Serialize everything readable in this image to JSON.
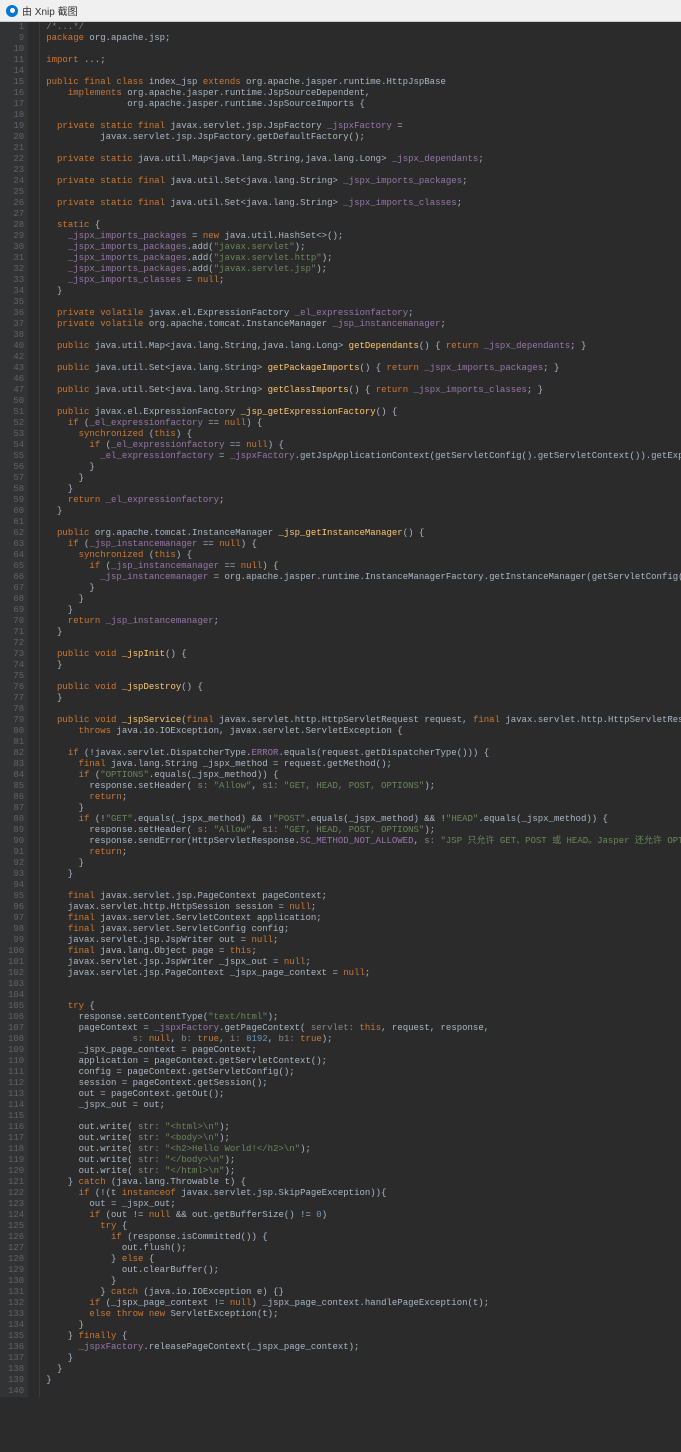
{
  "titlebar": {
    "text": "由 Xnip 截图"
  },
  "code": {
    "lines": [
      {
        "n": 1,
        "t": "<span class='cm'>/*...*/</span>"
      },
      {
        "n": 9,
        "t": "<span class='kw'>package</span> org.apache.jsp;"
      },
      {
        "n": 10,
        "t": ""
      },
      {
        "n": 11,
        "t": "<span class='kw'>import</span> ...;"
      },
      {
        "n": 14,
        "t": ""
      },
      {
        "n": 15,
        "t": "<span class='kw'>public final class</span> index_jsp <span class='kw'>extends</span> org.apache.jasper.runtime.HttpJspBase"
      },
      {
        "n": 16,
        "t": "    <span class='kw'>implements</span> org.apache.jasper.runtime.JspSourceDependent,"
      },
      {
        "n": 17,
        "t": "               org.apache.jasper.runtime.JspSourceImports {"
      },
      {
        "n": 18,
        "t": ""
      },
      {
        "n": 19,
        "t": "  <span class='kw'>private static final</span> javax.servlet.jsp.JspFactory <span class='field'>_jspxFactory</span> ="
      },
      {
        "n": 20,
        "t": "          javax.servlet.jsp.JspFactory.getDefaultFactory();"
      },
      {
        "n": 21,
        "t": ""
      },
      {
        "n": 22,
        "t": "  <span class='kw'>private static</span> java.util.Map&lt;java.lang.String,java.lang.Long&gt; <span class='field'>_jspx_dependants</span>;"
      },
      {
        "n": 23,
        "t": ""
      },
      {
        "n": 24,
        "t": "  <span class='kw'>private static final</span> java.util.Set&lt;java.lang.String&gt; <span class='field'>_jspx_imports_packages</span>;"
      },
      {
        "n": 25,
        "t": ""
      },
      {
        "n": 26,
        "t": "  <span class='kw'>private static final</span> java.util.Set&lt;java.lang.String&gt; <span class='field'>_jspx_imports_classes</span>;"
      },
      {
        "n": 27,
        "t": ""
      },
      {
        "n": 28,
        "t": "  <span class='kw'>static</span> {"
      },
      {
        "n": 29,
        "t": "    <span class='field'>_jspx_imports_packages</span> = <span class='kw'>new</span> java.util.HashSet&lt;&gt;();"
      },
      {
        "n": 30,
        "t": "    <span class='field'>_jspx_imports_packages</span>.add(<span class='str'>\"javax.servlet\"</span>);"
      },
      {
        "n": 31,
        "t": "    <span class='field'>_jspx_imports_packages</span>.add(<span class='str'>\"javax.servlet.http\"</span>);"
      },
      {
        "n": 32,
        "t": "    <span class='field'>_jspx_imports_packages</span>.add(<span class='str'>\"javax.servlet.jsp\"</span>);"
      },
      {
        "n": 33,
        "t": "    <span class='field'>_jspx_imports_classes</span> = <span class='kw'>null</span>;"
      },
      {
        "n": 34,
        "t": "  }"
      },
      {
        "n": 35,
        "t": ""
      },
      {
        "n": 36,
        "t": "  <span class='kw'>private volatile</span> javax.el.ExpressionFactory <span class='field'>_el_expressionfactory</span>;"
      },
      {
        "n": 37,
        "t": "  <span class='kw'>private volatile</span> org.apache.tomcat.InstanceManager <span class='field'>_jsp_instancemanager</span>;"
      },
      {
        "n": 38,
        "t": ""
      },
      {
        "n": 40,
        "t": "  <span class='kw'>public</span> java.util.Map&lt;java.lang.String,java.lang.Long&gt; <span class='fn'>getDependants</span>() { <span class='kw'>return</span> <span class='field'>_jspx_dependants</span>; }"
      },
      {
        "n": 42,
        "t": ""
      },
      {
        "n": 43,
        "t": "  <span class='kw'>public</span> java.util.Set&lt;java.lang.String&gt; <span class='fn'>getPackageImports</span>() { <span class='kw'>return</span> <span class='field'>_jspx_imports_packages</span>; }"
      },
      {
        "n": 46,
        "t": ""
      },
      {
        "n": 47,
        "t": "  <span class='kw'>public</span> java.util.Set&lt;java.lang.String&gt; <span class='fn'>getClassImports</span>() { <span class='kw'>return</span> <span class='field'>_jspx_imports_classes</span>; }"
      },
      {
        "n": 50,
        "t": ""
      },
      {
        "n": 51,
        "t": "  <span class='kw'>public</span> javax.el.ExpressionFactory <span class='fn'>_jsp_getExpressionFactory</span>() {"
      },
      {
        "n": 52,
        "t": "    <span class='kw'>if</span> (<span class='field'>_el_expressionfactory</span> == <span class='kw'>null</span>) {"
      },
      {
        "n": 53,
        "t": "      <span class='kw'>synchronized</span> (<span class='kw'>this</span>) {"
      },
      {
        "n": 54,
        "t": "        <span class='kw'>if</span> (<span class='field'>_el_expressionfactory</span> == <span class='kw'>null</span>) {"
      },
      {
        "n": 55,
        "t": "          <span class='field'>_el_expressionfactory</span> = <span class='field'>_jspxFactory</span>.getJspApplicationContext(getServletConfig().getServletContext()).getExpressionFactory();"
      },
      {
        "n": 56,
        "t": "        }"
      },
      {
        "n": 57,
        "t": "      }"
      },
      {
        "n": 58,
        "t": "    }"
      },
      {
        "n": 59,
        "t": "    <span class='kw'>return</span> <span class='field'>_el_expressionfactory</span>;"
      },
      {
        "n": 60,
        "t": "  }"
      },
      {
        "n": 61,
        "t": ""
      },
      {
        "n": 62,
        "t": "  <span class='kw'>public</span> org.apache.tomcat.InstanceManager <span class='fn'>_jsp_getInstanceManager</span>() {"
      },
      {
        "n": 63,
        "t": "    <span class='kw'>if</span> (<span class='field'>_jsp_instancemanager</span> == <span class='kw'>null</span>) {"
      },
      {
        "n": 64,
        "t": "      <span class='kw'>synchronized</span> (<span class='kw'>this</span>) {"
      },
      {
        "n": 65,
        "t": "        <span class='kw'>if</span> (<span class='field'>_jsp_instancemanager</span> == <span class='kw'>null</span>) {"
      },
      {
        "n": 66,
        "t": "          <span class='field'>_jsp_instancemanager</span> = org.apache.jasper.runtime.InstanceManagerFactory.getInstanceManager(getServletConfig());"
      },
      {
        "n": 67,
        "t": "        }"
      },
      {
        "n": 68,
        "t": "      }"
      },
      {
        "n": 69,
        "t": "    }"
      },
      {
        "n": 70,
        "t": "    <span class='kw'>return</span> <span class='field'>_jsp_instancemanager</span>;"
      },
      {
        "n": 71,
        "t": "  }"
      },
      {
        "n": 72,
        "t": ""
      },
      {
        "n": 73,
        "t": "  <span class='kw'>public void</span> <span class='fn'>_jspInit</span>() {"
      },
      {
        "n": 74,
        "t": "  }"
      },
      {
        "n": 75,
        "t": ""
      },
      {
        "n": 76,
        "t": "  <span class='kw'>public void</span> <span class='fn'>_jspDestroy</span>() {"
      },
      {
        "n": 77,
        "t": "  }"
      },
      {
        "n": 78,
        "t": ""
      },
      {
        "n": 79,
        "t": "  <span class='kw'>public void</span> <span class='fn'>_jspService</span>(<span class='kw'>final</span> javax.servlet.http.HttpServletRequest request, <span class='kw'>final</span> javax.servlet.http.HttpServletResponse response)"
      },
      {
        "n": 80,
        "t": "      <span class='kw'>throws</span> java.io.IOException, javax.servlet.ServletException {"
      },
      {
        "n": 81,
        "t": ""
      },
      {
        "n": 82,
        "t": "    <span class='kw'>if</span> (!javax.servlet.DispatcherType.<span class='field'>ERROR</span>.equals(request.getDispatcherType())) {"
      },
      {
        "n": 83,
        "t": "      <span class='kw'>final</span> java.lang.String _jspx_method = request.getMethod();"
      },
      {
        "n": 84,
        "t": "      <span class='kw'>if</span> (<span class='str'>\"OPTIONS\"</span>.equals(_jspx_method)) {"
      },
      {
        "n": 85,
        "t": "        response.setHeader( <span class='param'>s:</span> <span class='str'>\"Allow\"</span>, <span class='param'>s1:</span> <span class='str'>\"GET, HEAD, POST, OPTIONS\"</span>);"
      },
      {
        "n": 86,
        "t": "        <span class='kw'>return</span>;"
      },
      {
        "n": 87,
        "t": "      }"
      },
      {
        "n": 88,
        "t": "      <span class='kw'>if</span> (!<span class='str'>\"GET\"</span>.equals(_jspx_method) &amp;&amp; !<span class='str'>\"POST\"</span>.equals(_jspx_method) &amp;&amp; !<span class='str'>\"HEAD\"</span>.equals(_jspx_method)) {"
      },
      {
        "n": 89,
        "t": "        response.setHeader( <span class='param'>s:</span> <span class='str'>\"Allow\"</span>, <span class='param'>s1:</span> <span class='str'>\"GET, HEAD, POST, OPTIONS\"</span>);"
      },
      {
        "n": 90,
        "t": "        response.sendError(HttpServletResponse.<span class='field'>SC_METHOD_NOT_ALLOWED</span>, <span class='param'>s:</span> <span class='str'>\"JSP 只允许 GET、POST 或 HEAD。Jasper 还允许 OPTIONS\"</span>);"
      },
      {
        "n": 91,
        "t": "        <span class='kw'>return</span>;"
      },
      {
        "n": 92,
        "t": "      }"
      },
      {
        "n": 93,
        "t": "    }"
      },
      {
        "n": 94,
        "t": ""
      },
      {
        "n": 95,
        "t": "    <span class='kw'>final</span> javax.servlet.jsp.PageContext pageContext;"
      },
      {
        "n": 96,
        "t": "    javax.servlet.http.HttpSession session = <span class='kw'>null</span>;"
      },
      {
        "n": 97,
        "t": "    <span class='kw'>final</span> javax.servlet.ServletContext application;"
      },
      {
        "n": 98,
        "t": "    <span class='kw'>final</span> javax.servlet.ServletConfig config;"
      },
      {
        "n": 99,
        "t": "    javax.servlet.jsp.JspWriter out = <span class='kw'>null</span>;"
      },
      {
        "n": 100,
        "t": "    <span class='kw'>final</span> java.lang.Object page = <span class='kw'>this</span>;"
      },
      {
        "n": 101,
        "t": "    javax.servlet.jsp.JspWriter _jspx_out = <span class='kw'>null</span>;"
      },
      {
        "n": 102,
        "t": "    javax.servlet.jsp.PageContext _jspx_page_context = <span class='kw'>null</span>;"
      },
      {
        "n": 103,
        "t": ""
      },
      {
        "n": 104,
        "t": ""
      },
      {
        "n": 105,
        "t": "    <span class='kw'>try</span> {"
      },
      {
        "n": 106,
        "t": "      response.setContentType(<span class='str'>\"text/html\"</span>);"
      },
      {
        "n": 107,
        "t": "      pageContext = <span class='field'>_jspxFactory</span>.getPageContext( <span class='param'>servlet:</span> <span class='kw'>this</span>, request, response,"
      },
      {
        "n": 108,
        "t": "                <span class='param'>s:</span> <span class='kw'>null</span>, <span class='param'>b:</span> <span class='kw'>true</span>, <span class='param'>i:</span> <span class='num'>8192</span>, <span class='param'>b1:</span> <span class='kw'>true</span>);"
      },
      {
        "n": 109,
        "t": "      _jspx_page_context = pageContext;"
      },
      {
        "n": 110,
        "t": "      application = pageContext.getServletContext();"
      },
      {
        "n": 111,
        "t": "      config = pageContext.getServletConfig();"
      },
      {
        "n": 112,
        "t": "      session = pageContext.getSession();"
      },
      {
        "n": 113,
        "t": "      out = pageContext.getOut();"
      },
      {
        "n": 114,
        "t": "      _jspx_out = out;"
      },
      {
        "n": 115,
        "t": ""
      },
      {
        "n": 116,
        "t": "      out.write( <span class='param'>str:</span> <span class='str'>\"&lt;html&gt;\\n\"</span>);"
      },
      {
        "n": 117,
        "t": "      out.write( <span class='param'>str:</span> <span class='str'>\"&lt;body&gt;\\n\"</span>);"
      },
      {
        "n": 118,
        "t": "      out.write( <span class='param'>str:</span> <span class='str'>\"&lt;h2&gt;Hello World!&lt;/h2&gt;\\n\"</span>);"
      },
      {
        "n": 119,
        "t": "      out.write( <span class='param'>str:</span> <span class='str'>\"&lt;/body&gt;\\n\"</span>);"
      },
      {
        "n": 120,
        "t": "      out.write( <span class='param'>str:</span> <span class='str'>\"&lt;/html&gt;\\n\"</span>);"
      },
      {
        "n": 121,
        "t": "    } <span class='kw'>catch</span> (java.lang.Throwable t) {"
      },
      {
        "n": 122,
        "t": "      <span class='kw'>if</span> (!(t <span class='kw'>instanceof</span> javax.servlet.jsp.SkipPageException)){"
      },
      {
        "n": 123,
        "t": "        out = _jspx_out;"
      },
      {
        "n": 124,
        "t": "        <span class='kw'>if</span> (out != <span class='kw'>null</span> &amp;&amp; out.getBufferSize() != <span class='num'>0</span>)"
      },
      {
        "n": 125,
        "t": "          <span class='kw'>try</span> {"
      },
      {
        "n": 126,
        "t": "            <span class='kw'>if</span> (response.isCommitted()) {"
      },
      {
        "n": 127,
        "t": "              out.flush();"
      },
      {
        "n": 128,
        "t": "            } <span class='kw'>else</span> {"
      },
      {
        "n": 129,
        "t": "              out.clearBuffer();"
      },
      {
        "n": 130,
        "t": "            }"
      },
      {
        "n": 131,
        "t": "          } <span class='kw'>catch</span> (java.io.IOException e) {}"
      },
      {
        "n": 132,
        "t": "        <span class='kw'>if</span> (_jspx_page_context != <span class='kw'>null</span>) _jspx_page_context.handlePageException(t);"
      },
      {
        "n": 133,
        "t": "        <span class='kw'>else throw new</span> ServletException(t);"
      },
      {
        "n": 134,
        "t": "      }"
      },
      {
        "n": 135,
        "t": "    } <span class='kw'>finally</span> {"
      },
      {
        "n": 136,
        "t": "      <span class='field'>_jspxFactory</span>.releasePageContext(_jspx_page_context);"
      },
      {
        "n": 137,
        "t": "    }"
      },
      {
        "n": 138,
        "t": "  }"
      },
      {
        "n": 139,
        "t": "}"
      },
      {
        "n": 140,
        "t": ""
      }
    ]
  }
}
